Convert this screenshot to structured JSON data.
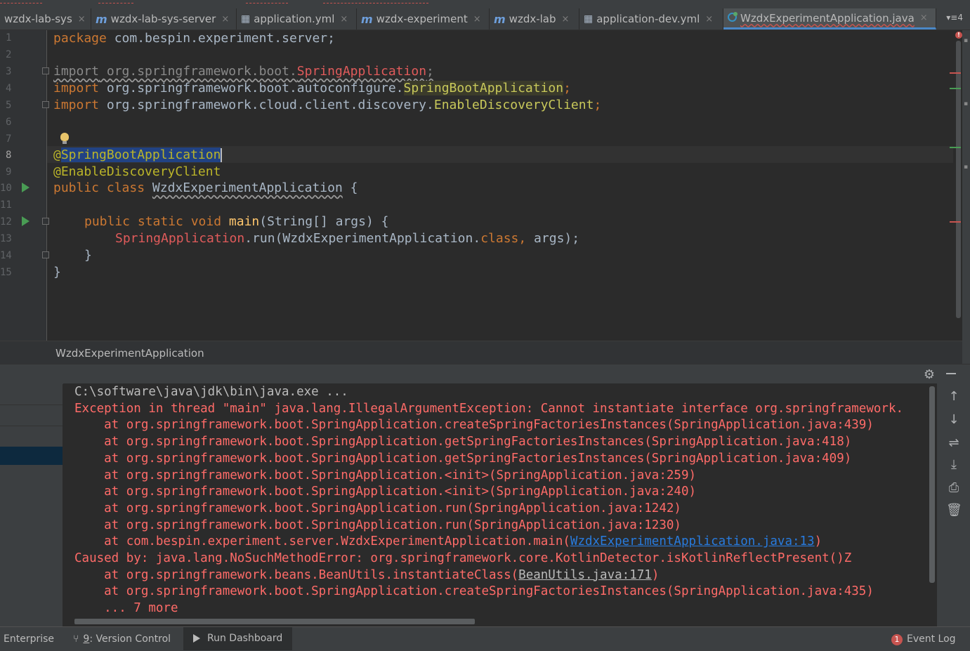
{
  "tabs": [
    {
      "label": "wzdx-lab-sys",
      "icon": "none",
      "closable": true
    },
    {
      "label": "wzdx-lab-sys-server",
      "icon": "maven-module-icon",
      "closable": true
    },
    {
      "label": "application.yml",
      "icon": "yaml-file-icon",
      "closable": true
    },
    {
      "label": "wzdx-experiment",
      "icon": "maven-module-icon",
      "closable": true
    },
    {
      "label": "wzdx-lab",
      "icon": "maven-module-icon",
      "closable": true
    },
    {
      "label": "application-dev.yml",
      "icon": "yaml-file-icon",
      "closable": true
    },
    {
      "label": "WzdxExperimentApplication.java",
      "icon": "java-class-icon",
      "closable": true,
      "active": true
    }
  ],
  "tab_overflow": "4",
  "close_glyph": "×",
  "editor": {
    "line_numbers": [
      "1",
      "2",
      "3",
      "4",
      "5",
      "6",
      "7",
      "8",
      "9",
      "10",
      "11",
      "12",
      "13",
      "14",
      "15"
    ],
    "current_line": "8",
    "lines": {
      "l1": {
        "kw": "package",
        "rest": " com.bespin.experiment.server;"
      },
      "l3": {
        "kw": "import",
        "pkg": " org.springframework.boot.",
        "cls": "SpringApplication",
        "end": ";"
      },
      "l4": {
        "kw": "import",
        "pkg": " org.springframework.boot.autoconfigure.",
        "cls": "SpringBootApplication",
        "end": ";"
      },
      "l5": {
        "kw": "import",
        "pkg": " org.springframework.cloud.client.discovery.",
        "cls": "EnableDiscoveryClient",
        "end": ";"
      },
      "l8": {
        "at": "@",
        "ann": "SpringBootApplication"
      },
      "l9": {
        "ann": "@EnableDiscoveryClient"
      },
      "l10": {
        "kw": "public class ",
        "name": "WzdxExperimentApplication",
        "end": " {"
      },
      "l12": {
        "kw": "public static void ",
        "fn": "main",
        "args": "(String[] args) {"
      },
      "l13": {
        "cls": "SpringApplication",
        "call": ".run(WzdxExperimentApplication.",
        "kw": "class",
        "comma": ",",
        "end": " args);"
      },
      "l14": {
        "text": "}"
      },
      "l15": {
        "text": "}"
      }
    }
  },
  "breadcrumb": "WzdxExperimentApplication",
  "console": {
    "lines": [
      {
        "text": "C:\\software\\java\\jdk\\bin\\java.exe ...",
        "style": "grey"
      },
      {
        "text": "Exception in thread \"main\" java.lang.IllegalArgumentException: Cannot instantiate interface org.springframework.",
        "style": "err"
      },
      {
        "text": "    at org.springframework.boot.SpringApplication.createSpringFactoriesInstances(SpringApplication.java:439)",
        "style": "err"
      },
      {
        "text": "    at org.springframework.boot.SpringApplication.getSpringFactoriesInstances(SpringApplication.java:418)",
        "style": "err"
      },
      {
        "text": "    at org.springframework.boot.SpringApplication.getSpringFactoriesInstances(SpringApplication.java:409)",
        "style": "err"
      },
      {
        "text": "    at org.springframework.boot.SpringApplication.<init>(SpringApplication.java:259)",
        "style": "err"
      },
      {
        "text": "    at org.springframework.boot.SpringApplication.<init>(SpringApplication.java:240)",
        "style": "err"
      },
      {
        "text": "    at org.springframework.boot.SpringApplication.run(SpringApplication.java:1242)",
        "style": "err"
      },
      {
        "text": "    at org.springframework.boot.SpringApplication.run(SpringApplication.java:1230)",
        "style": "err"
      },
      {
        "prefix": "    at com.bespin.experiment.server.WzdxExperimentApplication.main(",
        "link": "WzdxExperimentApplication.java:13",
        "suffix": ")",
        "style": "err-link"
      },
      {
        "text": "Caused by: java.lang.NoSuchMethodError: org.springframework.core.KotlinDetector.isKotlinReflectPresent()Z",
        "style": "err"
      },
      {
        "prefix": "    at org.springframework.beans.BeanUtils.instantiateClass(",
        "link": "BeanUtils.java:171",
        "suffix": ")",
        "style": "err-ul"
      },
      {
        "text": "    at org.springframework.boot.SpringApplication.createSpringFactoriesInstances(SpringApplication.java:435)",
        "style": "err"
      },
      {
        "text": "    ... 7 more",
        "style": "err"
      }
    ]
  },
  "statusbar": {
    "enterprise": "Enterprise",
    "vcs_num": "9",
    "vcs_label": ": Version Control",
    "run_dashboard": "Run Dashboard",
    "event_count": "1",
    "event_log": "Event Log"
  },
  "colors": {
    "error": "#ff6b68",
    "keyword": "#cc7832",
    "annotation": "#bbb529",
    "selection": "#214283"
  }
}
